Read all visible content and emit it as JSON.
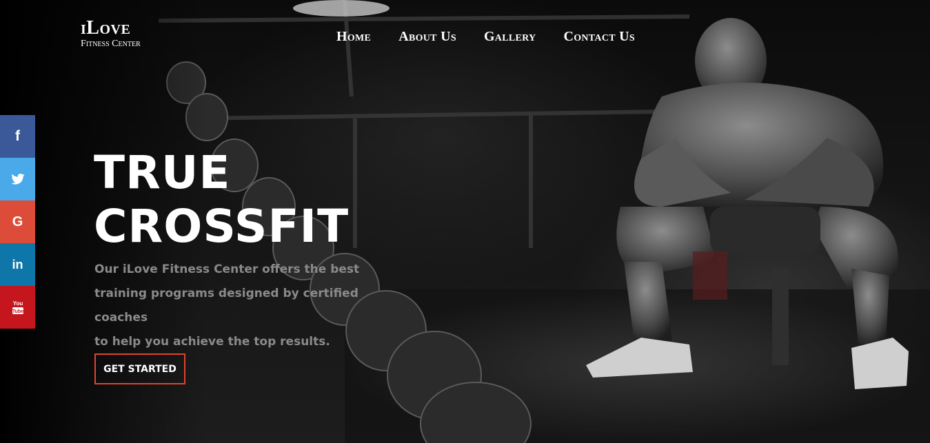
{
  "brand": {
    "name": "iLove",
    "subtitle": "Fitness Center"
  },
  "nav": {
    "items": [
      {
        "label": "Home"
      },
      {
        "label": "About Us"
      },
      {
        "label": "Gallery"
      },
      {
        "label": "Contact Us"
      }
    ]
  },
  "social": [
    {
      "icon": "facebook-icon",
      "glyph": "f",
      "color": "#3b5998"
    },
    {
      "icon": "twitter-icon",
      "glyph": "🐦",
      "color": "#4aa9e8"
    },
    {
      "icon": "google-icon",
      "glyph": "G",
      "color": "#dd4b39"
    },
    {
      "icon": "linkedin-icon",
      "glyph": "in",
      "color": "#0e76a8"
    },
    {
      "icon": "youtube-icon",
      "glyph": "You Tube",
      "color": "#c4161c"
    }
  ],
  "hero": {
    "headline_line1": "TRUE",
    "headline_line2": "CROSSFIT",
    "tagline_line1": "Our iLove Fitness Center offers the best",
    "tagline_line2": "training programs designed by certified coaches",
    "tagline_line3": "to help you achieve the top results.",
    "cta_label": "GET STARTED",
    "accent_color": "#e0452b"
  }
}
